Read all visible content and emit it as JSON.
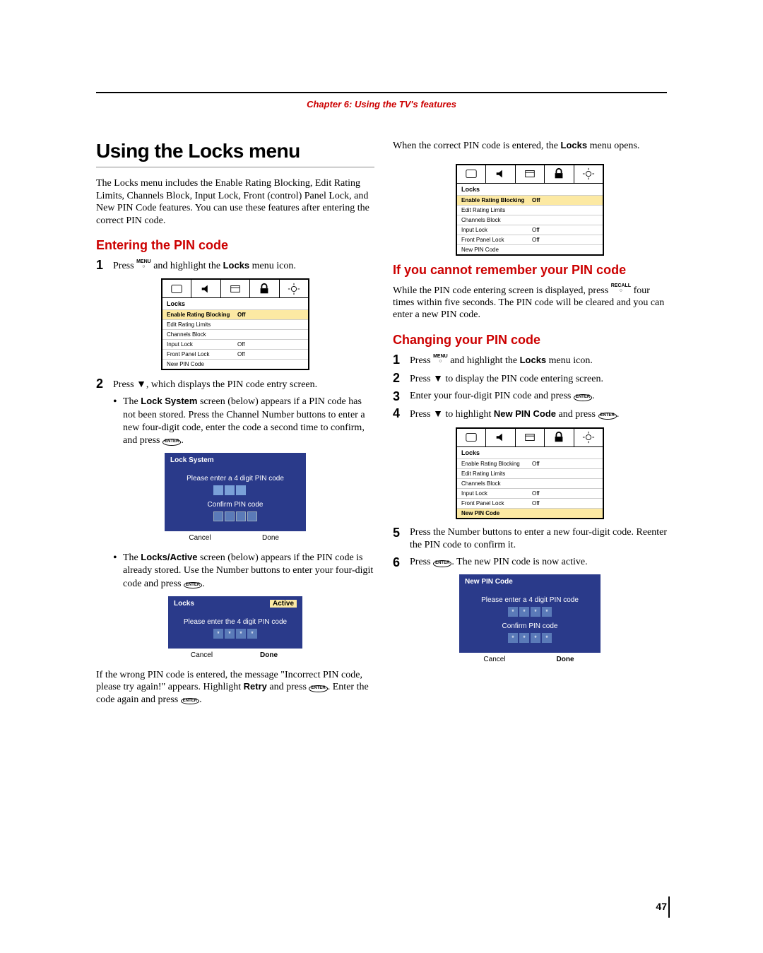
{
  "chapter": "Chapter 6: Using the TV's features",
  "h1": "Using the Locks menu",
  "intro": "The Locks menu includes the Enable Rating Blocking, Edit Rating Limits, Channels Block, Input Lock, Front (control) Panel Lock, and New PIN Code features. You can use these features after entering the correct PIN code.",
  "h2_enter": "Entering the PIN code",
  "left": {
    "step1_a": "Press ",
    "step1_menu": "MENU",
    "step1_b": " and highlight the ",
    "step1_bold": "Locks",
    "step1_c": " menu icon.",
    "step2_a": "Press ",
    "step2_arrow": "▼",
    "step2_b": ", which displays the PIN code entry screen.",
    "bullet1_a": "The ",
    "bullet1_bold": "Lock System",
    "bullet1_b": " screen (below) appears if a PIN code has not been stored. Press the Channel Number buttons to enter a new four-digit code, enter the code a second time to confirm, and press ",
    "bullet1_enter": "ENTER",
    "bullet1_c": ".",
    "bullet2_a": "The ",
    "bullet2_bold": "Locks/Active",
    "bullet2_b": " screen (below) appears if the PIN code is already stored. Use the Number buttons to enter your four-digit code and press ",
    "bullet2_enter": "ENTER",
    "bullet2_c": ".",
    "wrong_a": "If the wrong PIN code is entered, the message \"Incorrect PIN code, please try again!\" appears. Highlight ",
    "wrong_bold": "Retry",
    "wrong_b": " and press ",
    "wrong_enter1": "ENTER",
    "wrong_c": ". Enter the code again and press ",
    "wrong_enter2": "ENTER",
    "wrong_d": "."
  },
  "right": {
    "top_a": "When the correct PIN code is entered, the ",
    "top_bold": "Locks",
    "top_b": " menu opens.",
    "h2_forgot": "If you cannot remember your PIN code",
    "forgot_a": "While the PIN code entering screen is displayed, press ",
    "forgot_recall": "RECALL",
    "forgot_b": " four times within five seconds. The PIN code will be cleared and you can enter a new PIN code.",
    "h2_change": "Changing your PIN code",
    "s1_a": "Press ",
    "s1_menu": "MENU",
    "s1_b": " and highlight the ",
    "s1_bold": "Locks",
    "s1_c": " menu icon.",
    "s2_a": "Press ",
    "s2_arrow": "▼",
    "s2_b": " to display the PIN code entering screen.",
    "s3_a": "Enter your four-digit PIN code and press ",
    "s3_enter": "ENTER",
    "s3_b": ".",
    "s4_a": "Press ",
    "s4_arrow": "▼",
    "s4_b": " to highlight ",
    "s4_bold": "New PIN Code",
    "s4_c": " and press ",
    "s4_enter": "ENTER",
    "s4_d": ".",
    "s5": "Press the Number buttons to enter a new four-digit code. Reenter the PIN code to confirm it.",
    "s6_a": "Press ",
    "s6_enter": "ENTER",
    "s6_b": ". The new PIN code is now active."
  },
  "menu": {
    "title": "Locks",
    "rows": [
      {
        "label": "Enable Rating Blocking",
        "value": "Off"
      },
      {
        "label": "Edit Rating Limits",
        "value": ""
      },
      {
        "label": "Channels Block",
        "value": ""
      },
      {
        "label": "Input Lock",
        "value": "Off"
      },
      {
        "label": "Front Panel Lock",
        "value": "Off"
      },
      {
        "label": "New PIN Code",
        "value": ""
      }
    ]
  },
  "dlg_lock": {
    "title": "Lock System",
    "line1": "Please enter a 4 digit PIN code",
    "line2": "Confirm PIN code",
    "cancel": "Cancel",
    "done": "Done"
  },
  "dlg_active": {
    "title_left": "Locks",
    "title_right": "Active",
    "line1": "Please enter the 4 digit PIN code",
    "cancel": "Cancel",
    "done": "Done"
  },
  "dlg_newpin": {
    "title": "New PIN Code",
    "line1": "Please enter a 4 digit PIN code",
    "line2": "Confirm PIN code",
    "cancel": "Cancel",
    "done": "Done"
  },
  "page_num": "47"
}
